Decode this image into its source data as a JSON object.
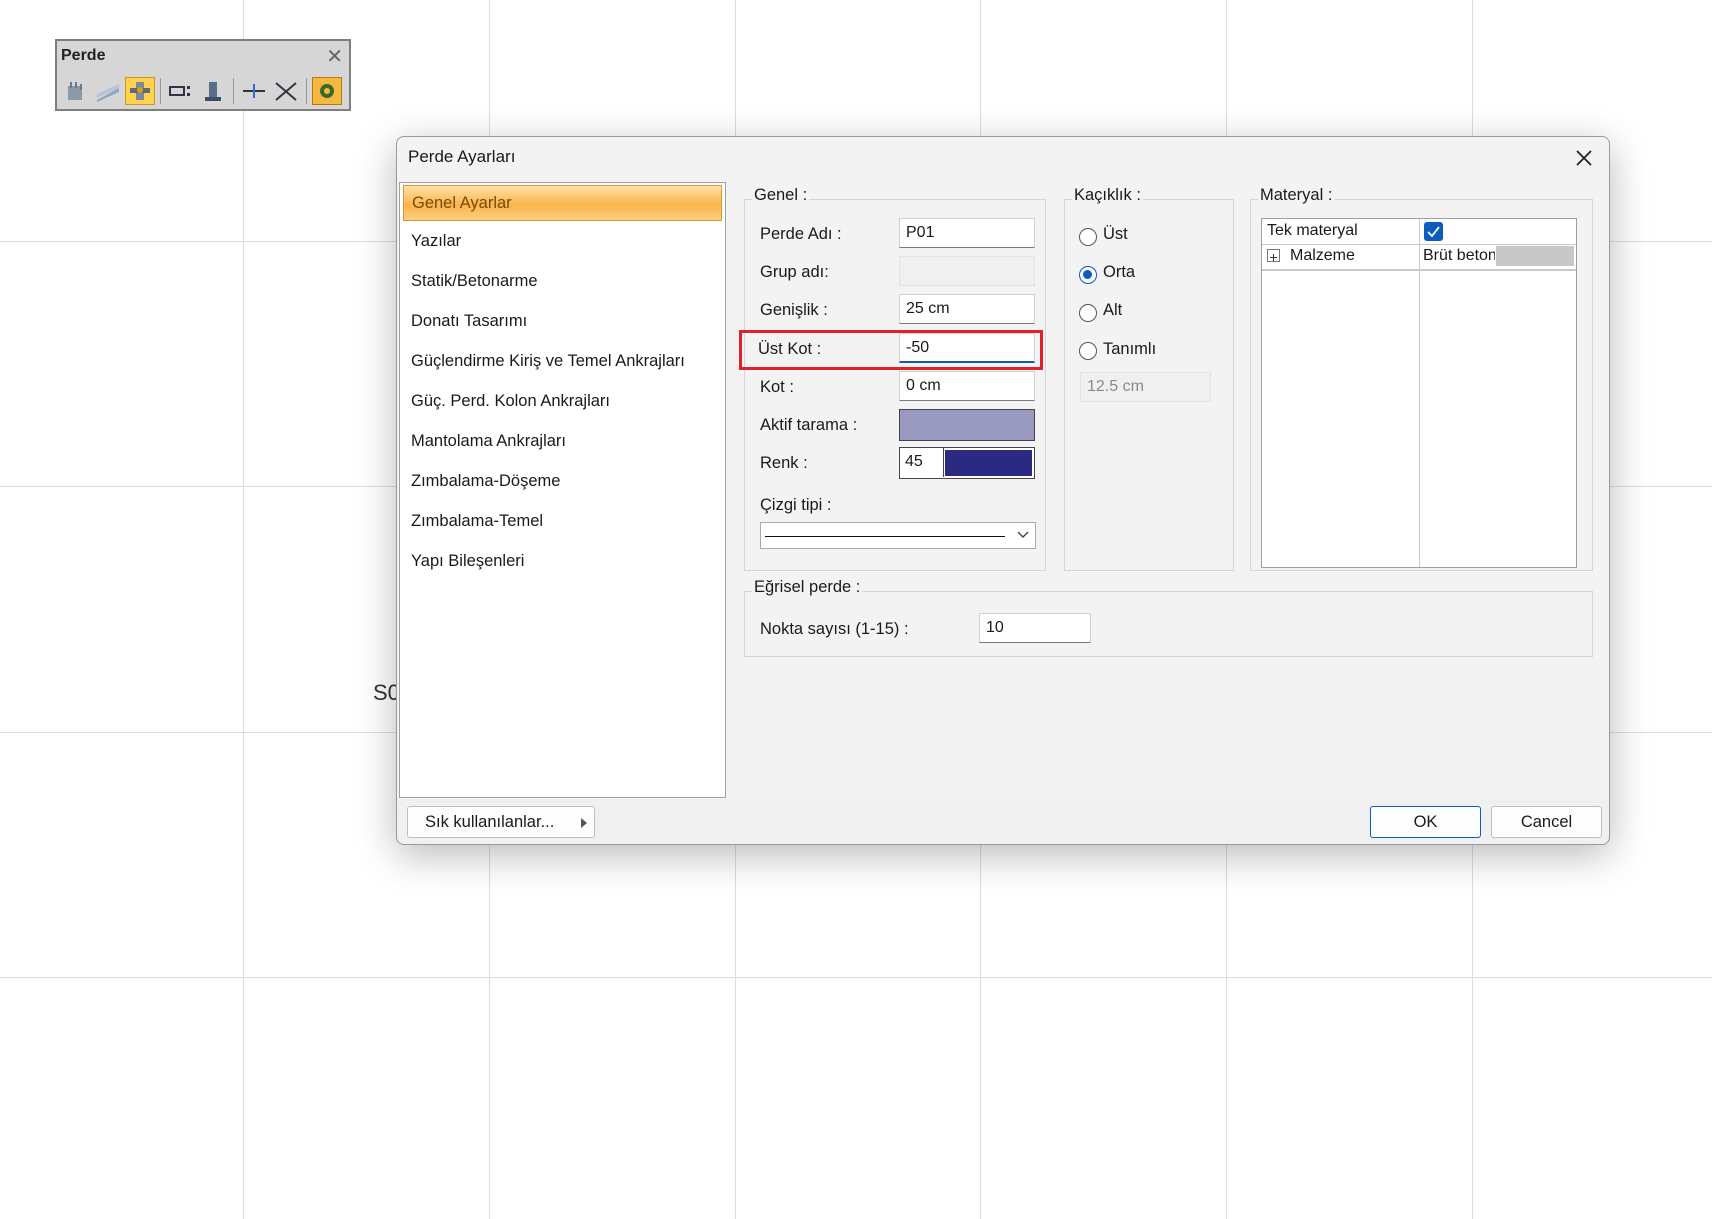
{
  "canvas": {
    "partial_text": "S0"
  },
  "toolbar": {
    "title": "Perde",
    "tools": [
      "wall-icon",
      "wall-slope-icon",
      "wall-multi-icon",
      "wall-opening-icon",
      "column-icon",
      "split-icon",
      "join-icon",
      "settings-icon"
    ]
  },
  "dialog": {
    "title": "Perde Ayarları",
    "nav": [
      "Genel Ayarlar",
      "Yazılar",
      "Statik/Betonarme",
      "Donatı Tasarımı",
      "Güçlendirme Kiriş ve Temel Ankrajları",
      "Güç. Perd. Kolon Ankrajları",
      "Mantolama Ankrajları",
      "Zımbalama-Döşeme",
      "Zımbalama-Temel",
      "Yapı Bileşenleri"
    ],
    "genel": {
      "label": "Genel :",
      "perde_adi_label": "Perde Adı :",
      "perde_adi": "P01",
      "grup_adi_label": "Grup adı:",
      "grup_adi": "",
      "genislik_label": "Genişlik :",
      "genislik": "25 cm",
      "ust_kot_label": "Üst Kot :",
      "ust_kot": "-50",
      "kot_label": "Kot :",
      "kot": "0 cm",
      "aktif_tarama_label": "Aktif tarama :",
      "renk_label": "Renk :",
      "renk_value": "45",
      "renk_color": "#2a2a82",
      "cizgi_tipi_label": "Çizgi tipi :"
    },
    "kaciklik": {
      "label": "Kaçıklık :",
      "options": [
        "Üst",
        "Orta",
        "Alt",
        "Tanımlı"
      ],
      "selected": "Orta",
      "tanimli_value": "12.5 cm"
    },
    "materyal": {
      "label": "Materyal :",
      "tek_materyal_label": "Tek materyal",
      "tek_materyal_checked": true,
      "malzeme_label": "Malzeme",
      "malzeme_value": "Brüt beton"
    },
    "egrisel": {
      "label": "Eğrisel perde :",
      "nokta_label": "Nokta sayısı (1-15) :",
      "nokta_value": "10"
    },
    "footer": {
      "sik_label": "Sık kullanılanlar...",
      "ok_label": "OK",
      "cancel_label": "Cancel"
    }
  }
}
